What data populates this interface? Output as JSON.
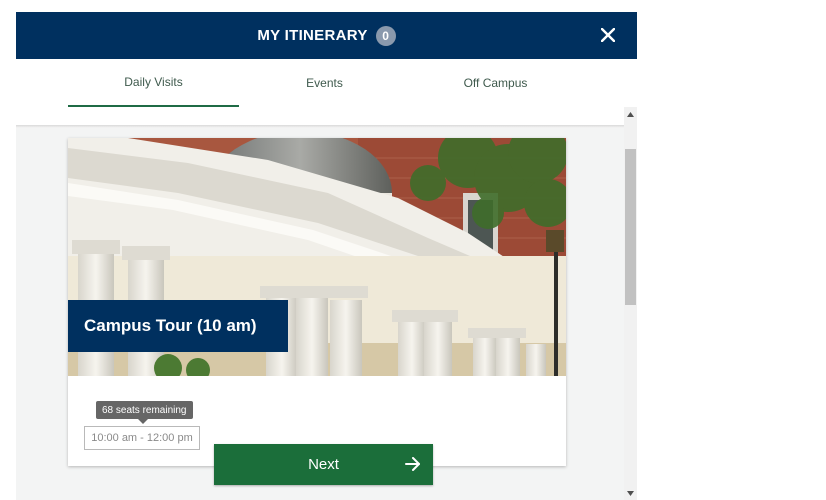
{
  "header": {
    "title": "MY ITINERARY",
    "count": "0",
    "close_icon": "close-icon"
  },
  "tabs": [
    {
      "label": "Daily Visits",
      "active": true
    },
    {
      "label": "Events",
      "active": false
    },
    {
      "label": "Off Campus",
      "active": false
    }
  ],
  "card": {
    "title": "Campus Tour (10 am)",
    "seats_remaining": "68 seats remaining",
    "time_slot": "10:00 am - 12:00 pm"
  },
  "next_button": {
    "label": "Next",
    "icon": "arrow-right-icon"
  },
  "colors": {
    "header_bg": "#00305f",
    "accent_green": "#1b6e3a",
    "tab_underline": "#1f6b45"
  }
}
